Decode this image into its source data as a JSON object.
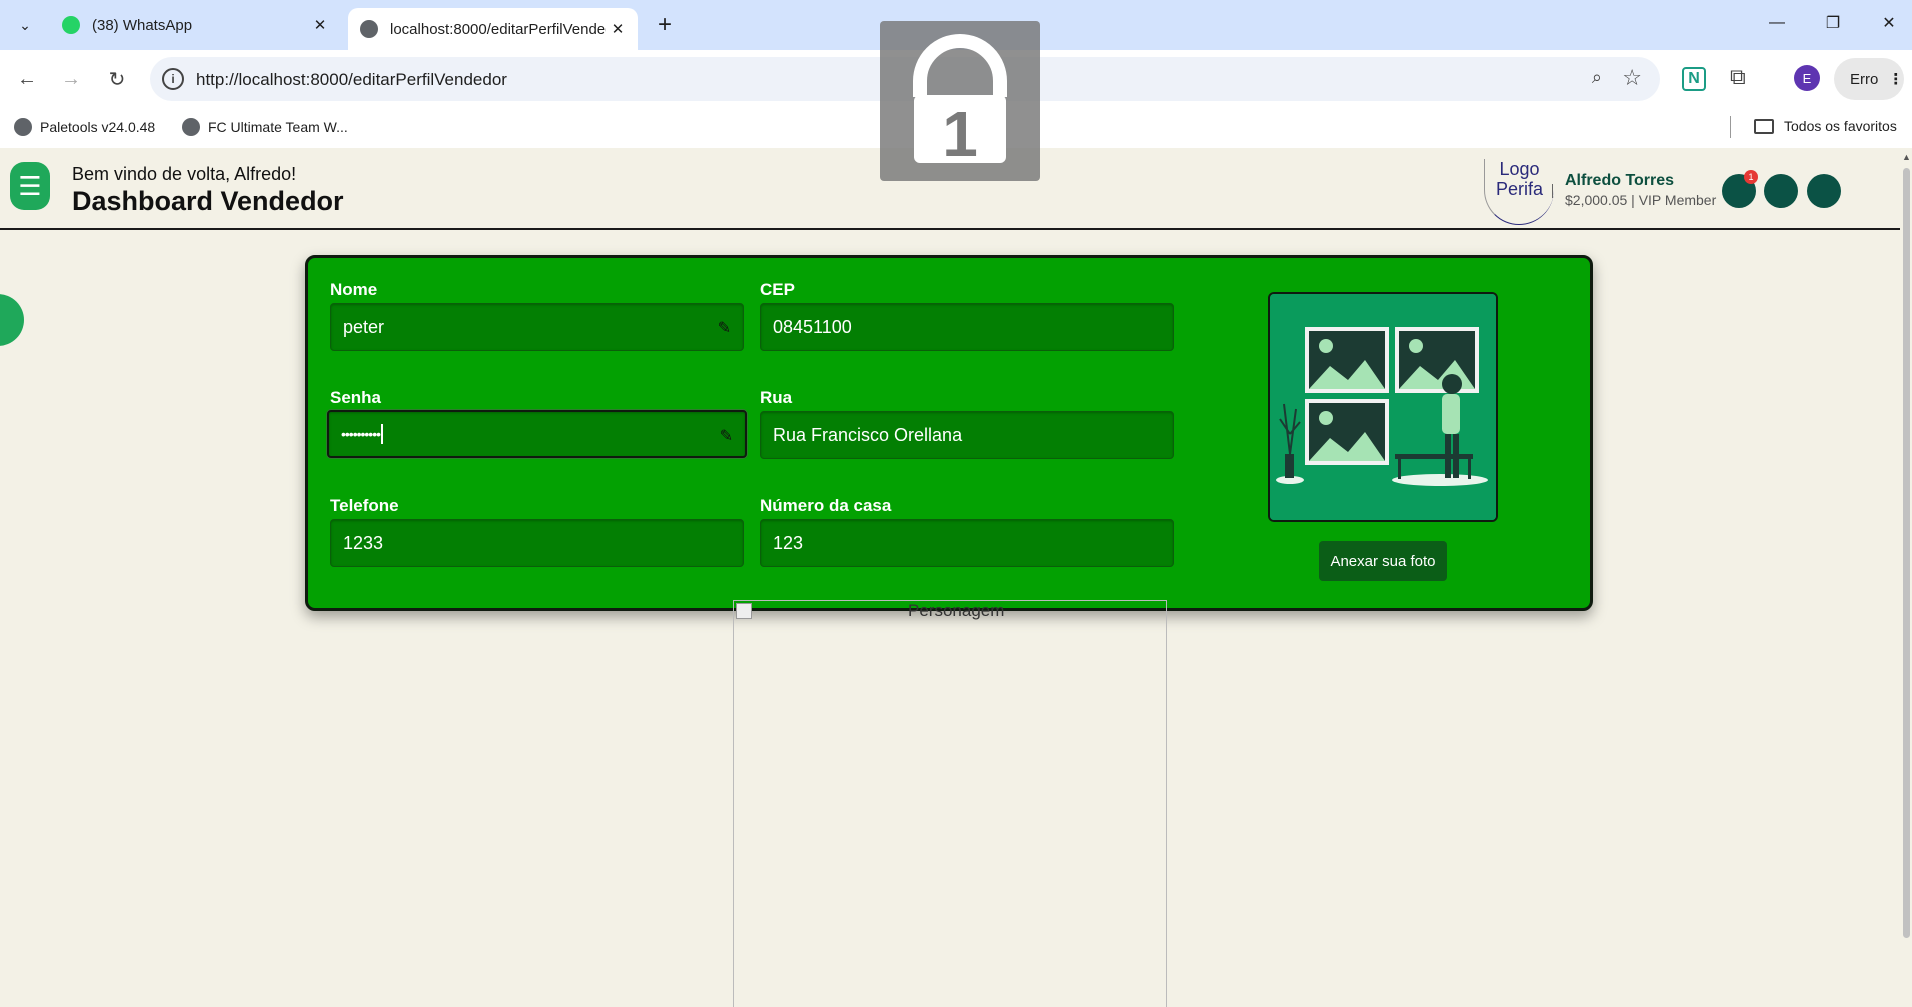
{
  "browser": {
    "tabs": [
      {
        "title": "(38) WhatsApp",
        "active": false
      },
      {
        "title": "localhost:8000/editarPerfilVendedor",
        "active": true
      }
    ],
    "url": "http://localhost:8000/editarPerfilVendedor",
    "profile_initial": "E",
    "error_label": "Erro",
    "bookmarks": [
      "Paletools v24.0.48",
      "FC Ultimate Team W..."
    ],
    "all_bookmarks_label": "Todos os favoritos"
  },
  "header": {
    "welcome": "Bem vindo de volta, Alfredo!",
    "title": "Dashboard Vendedor",
    "logo_alt": "Logo Perifa",
    "user_name": "Alfredo Torres",
    "user_meta": "$2,000.05 | VIP Member",
    "notification_count": "1"
  },
  "form": {
    "nome": {
      "label": "Nome",
      "value": "peter"
    },
    "cep": {
      "label": "CEP",
      "value": "08451100"
    },
    "senha": {
      "label": "Senha",
      "value": "••••••••••"
    },
    "rua": {
      "label": "Rua",
      "value": "Rua Francisco Orellana"
    },
    "telefone": {
      "label": "Telefone",
      "value": "1233"
    },
    "numero": {
      "label": "Número da casa",
      "value": "123"
    },
    "attach_label": "Anexar sua foto"
  },
  "character_image_alt": "Personagem",
  "overlay_number": "1",
  "colors": {
    "card_bg": "#03a102",
    "field_bg": "#037f03",
    "accent_dark": "#0b5245",
    "menu_green": "#1fa85a"
  }
}
